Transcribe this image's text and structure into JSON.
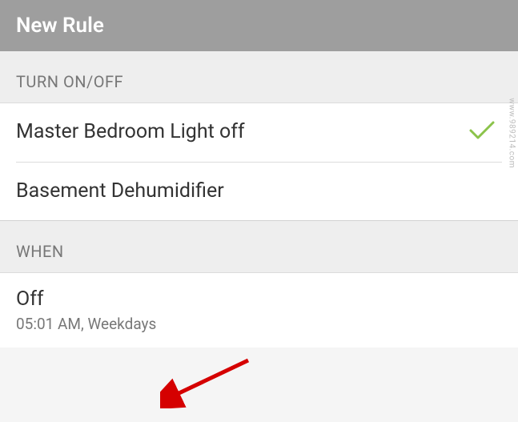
{
  "header": {
    "title": "New Rule"
  },
  "sections": {
    "turn": {
      "label": "TURN ON/OFF",
      "items": [
        {
          "label": "Master Bedroom Light off",
          "selected": true
        },
        {
          "label": "Basement Dehumidifier",
          "selected": false
        }
      ]
    },
    "when": {
      "label": "WHEN",
      "item": {
        "state": "Off",
        "schedule": "05:01 AM, Weekdays"
      }
    }
  },
  "watermark": "www.989214.com",
  "colors": {
    "accent": "#8bc34a",
    "annotation": "#d50000"
  }
}
